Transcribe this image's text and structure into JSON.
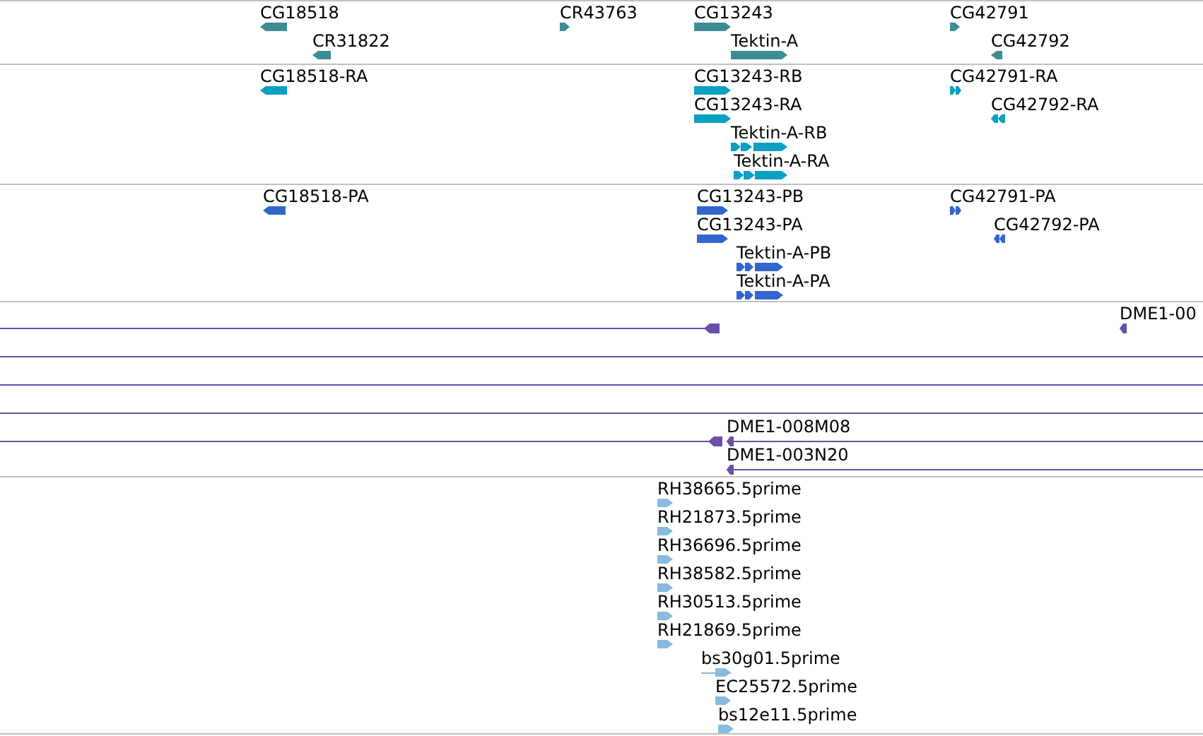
{
  "tracks": [
    {
      "kind": "gene",
      "features": [
        {
          "label": "CG18518",
          "reverse": true
        },
        {
          "label": "CR31822",
          "reverse": true
        },
        {
          "label": "CR43763",
          "reverse": false
        },
        {
          "label": "CG13243",
          "reverse": false
        },
        {
          "label": "Tektin-A",
          "reverse": false
        },
        {
          "label": "CG42791",
          "reverse": false
        },
        {
          "label": "CG42792",
          "reverse": true
        }
      ]
    },
    {
      "kind": "transcript",
      "features": [
        {
          "label": "CG18518-RA",
          "reverse": true
        },
        {
          "label": "CG13243-RB",
          "reverse": false
        },
        {
          "label": "CG13243-RA",
          "reverse": false
        },
        {
          "label": "Tektin-A-RB",
          "reverse": false
        },
        {
          "label": "Tektin-A-RA",
          "reverse": false
        },
        {
          "label": "CG42791-RA",
          "reverse": false
        },
        {
          "label": "CG42792-RA",
          "reverse": true
        }
      ]
    },
    {
      "kind": "protein",
      "features": [
        {
          "label": "CG18518-PA",
          "reverse": true
        },
        {
          "label": "CG13243-PB",
          "reverse": false
        },
        {
          "label": "CG13243-PA",
          "reverse": false
        },
        {
          "label": "Tektin-A-PB",
          "reverse": false
        },
        {
          "label": "Tektin-A-PA",
          "reverse": false
        },
        {
          "label": "CG42791-PA",
          "reverse": false
        },
        {
          "label": "CG42792-PA",
          "reverse": true
        }
      ]
    },
    {
      "kind": "clone",
      "features": [
        {
          "kind": "clone",
          "reverse": true
        },
        {
          "kind": "clone",
          "label": "DME1-00",
          "reverse": true
        },
        {
          "kind": "span"
        },
        {
          "kind": "span"
        },
        {
          "kind": "span"
        },
        {
          "kind": "clone",
          "reverse": true
        },
        {
          "kind": "clone",
          "label": "DME1-008M08",
          "reverse": true
        },
        {
          "kind": "clone",
          "label": "DME1-003N20",
          "reverse": true
        }
      ]
    },
    {
      "kind": "est",
      "features": [
        {
          "label": "RH38665.5prime",
          "reverse": false
        },
        {
          "label": "RH21873.5prime",
          "reverse": false
        },
        {
          "label": "RH36696.5prime",
          "reverse": false
        },
        {
          "label": "RH38582.5prime",
          "reverse": false
        },
        {
          "label": "RH30513.5prime",
          "reverse": false
        },
        {
          "label": "RH21869.5prime",
          "reverse": false
        },
        {
          "label": "bs30g01.5prime",
          "reverse": false
        },
        {
          "label": "EC25572.5prime",
          "reverse": false
        },
        {
          "label": "bs12e11.5prime",
          "reverse": false
        }
      ]
    }
  ]
}
